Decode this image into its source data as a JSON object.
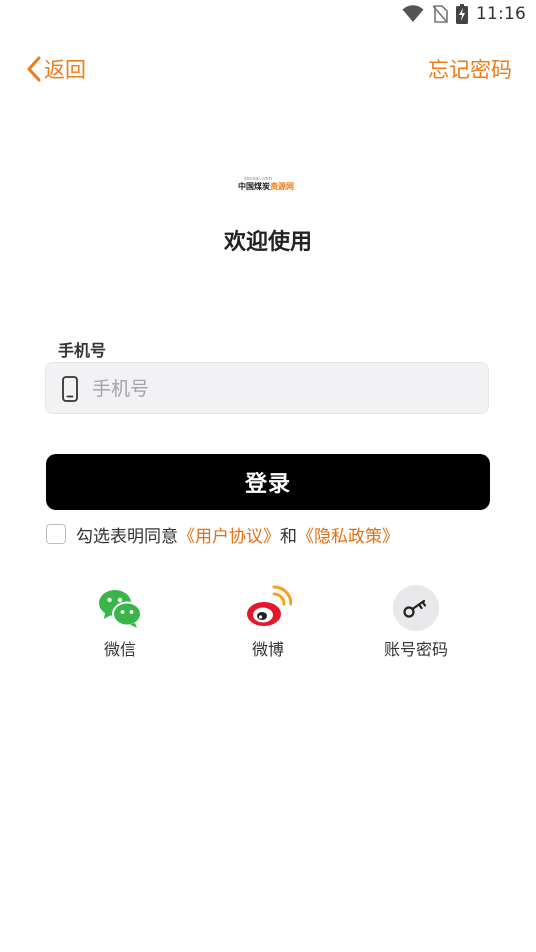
{
  "status_bar": {
    "time": "11:16",
    "icons": [
      "wifi-icon",
      "no-sim-icon",
      "battery-charging-icon"
    ]
  },
  "header": {
    "back_label": "返回",
    "forgot_label": "忘记密码"
  },
  "logo": {
    "domain_text": "sxcoal.com",
    "name_dark": "中国煤炭",
    "name_orange": "资源网"
  },
  "welcome": "欢迎使用",
  "phone": {
    "label": "手机号",
    "placeholder": "手机号",
    "value": ""
  },
  "login_label": "登录",
  "agreement": {
    "prefix": "勾选表明同意",
    "user_agreement": "《用户协议》",
    "and": "和",
    "privacy_policy": "《隐私政策》",
    "checked": false
  },
  "social": [
    {
      "label": "微信",
      "icon": "wechat-icon"
    },
    {
      "label": "微博",
      "icon": "weibo-icon"
    },
    {
      "label": "账号密码",
      "icon": "key-icon"
    }
  ],
  "colors": {
    "accent": "#f07a16",
    "link": "#e46e12",
    "button": "#000000",
    "wechat": "#39b54a",
    "weibo": "#e6162d"
  }
}
